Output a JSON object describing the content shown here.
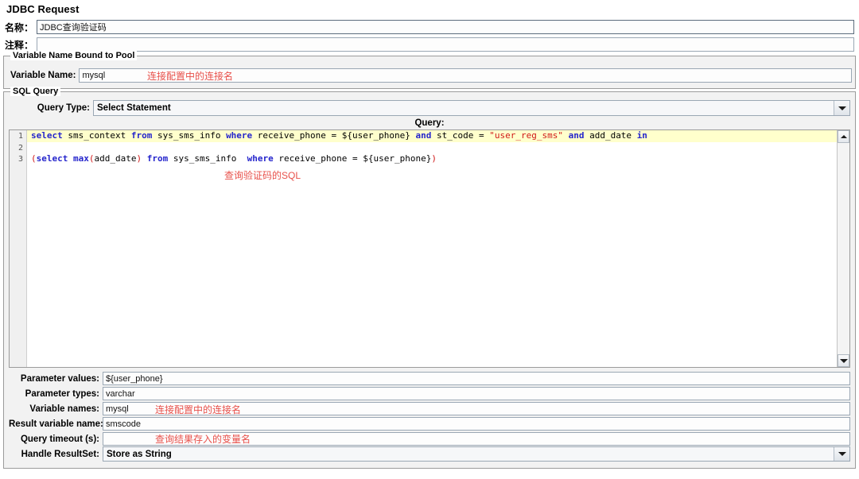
{
  "header": {
    "title": "JDBC Request"
  },
  "name_row": {
    "label": "名称：",
    "value": "JDBC查询验证码"
  },
  "comment_row": {
    "label": "注释：",
    "value": ""
  },
  "pool_group": {
    "title": "Variable Name Bound to Pool",
    "variable_name_label": "Variable Name:",
    "variable_name_value": "mysql",
    "annotation": "连接配置中的连接名"
  },
  "sql_group": {
    "title": "SQL Query",
    "query_type_label": "Query Type:",
    "query_type_value": "Select Statement",
    "query_caption": "Query:",
    "annotation": "查询验证码的SQL",
    "line_numbers": [
      "1",
      "2",
      "3"
    ],
    "code_lines": [
      [
        {
          "t": "select",
          "c": "kw"
        },
        {
          "t": " sms_context ",
          "c": ""
        },
        {
          "t": "from",
          "c": "kw"
        },
        {
          "t": " sys_sms_info ",
          "c": ""
        },
        {
          "t": "where",
          "c": "kw"
        },
        {
          "t": " receive_phone = ${user_phone} ",
          "c": ""
        },
        {
          "t": "and",
          "c": "kw"
        },
        {
          "t": " st_code = ",
          "c": ""
        },
        {
          "t": "\"user_reg_sms\"",
          "c": "str"
        },
        {
          "t": " ",
          "c": ""
        },
        {
          "t": "and",
          "c": "kw"
        },
        {
          "t": " add_date ",
          "c": ""
        },
        {
          "t": "in",
          "c": "kw"
        }
      ],
      [],
      [
        {
          "t": "(",
          "c": "punc"
        },
        {
          "t": "select",
          "c": "kw"
        },
        {
          "t": " ",
          "c": ""
        },
        {
          "t": "max",
          "c": "kw"
        },
        {
          "t": "(",
          "c": "punc"
        },
        {
          "t": "add_date",
          "c": ""
        },
        {
          "t": ")",
          "c": "punc"
        },
        {
          "t": " ",
          "c": ""
        },
        {
          "t": "from",
          "c": "kw"
        },
        {
          "t": " sys_sms_info  ",
          "c": ""
        },
        {
          "t": "where",
          "c": "kw"
        },
        {
          "t": " receive_phone = ${user_phone}",
          "c": ""
        },
        {
          "t": ")",
          "c": "punc"
        }
      ]
    ]
  },
  "params": {
    "parameter_values": {
      "label": "Parameter values:",
      "value": "${user_phone}"
    },
    "parameter_types": {
      "label": "Parameter types:",
      "value": "varchar"
    },
    "variable_names": {
      "label": "Variable names:",
      "value": "mysql",
      "annotation": "连接配置中的连接名"
    },
    "result_variable_name": {
      "label": "Result variable name:",
      "value": "smscode",
      "annotation": "查询结果存入的变量名"
    },
    "query_timeout": {
      "label": "Query timeout (s):",
      "value": ""
    },
    "handle_resultset": {
      "label": "Handle ResultSet:",
      "value": "Store as String"
    }
  },
  "icons": {
    "combo_arrow": "chevron-down-icon",
    "scroll_up": "scroll-up-arrow-icon",
    "scroll_down": "scroll-down-arrow-icon"
  },
  "colors": {
    "annotation_red": "#e8504a",
    "sql_keyword_blue": "#2525cc",
    "sql_string_red": "#d01818",
    "highlight_line": "#ffffcc"
  }
}
